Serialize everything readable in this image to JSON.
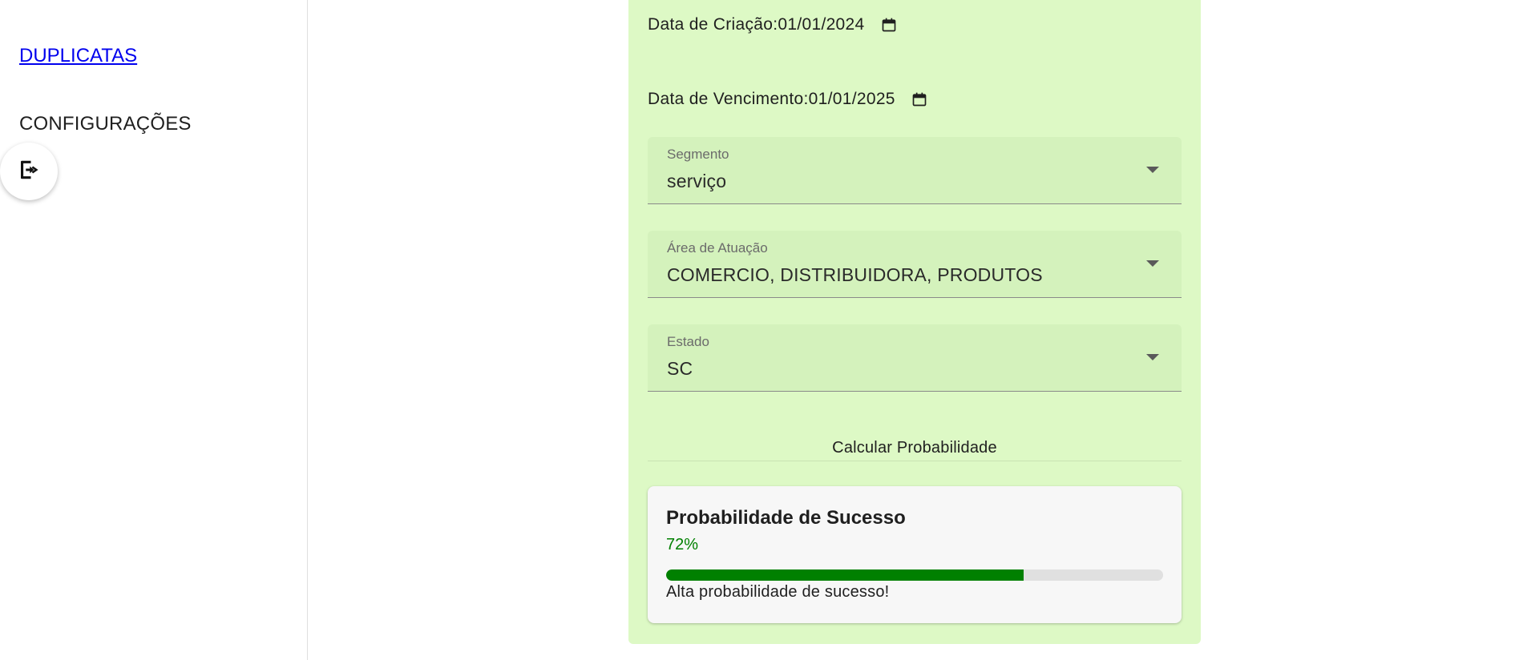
{
  "sidebar": {
    "nav_link": "DUPLICATAS",
    "nav_config": "CONFIGURAÇÕES",
    "logout_icon": "logout-icon"
  },
  "form": {
    "creation_date_label": "Data de Criação:",
    "creation_date_value": "01/01/2024",
    "due_date_label": "Data de Vencimento:",
    "due_date_value": "01/01/2025",
    "segment": {
      "label": "Segmento",
      "value": "serviço"
    },
    "area": {
      "label": "Área de Atuação",
      "value": "COMERCIO, DISTRIBUIDORA, PRODUTOS"
    },
    "state": {
      "label": "Estado",
      "value": "SC"
    },
    "calculate_button": "Calcular Probabilidade"
  },
  "result": {
    "title": "Probabilidade de Sucesso",
    "percent_text": "72%",
    "percent_value": 72,
    "message": "Alta probabilidade de sucesso!"
  },
  "colors": {
    "panel_bg": "#ddf9c5",
    "field_bg": "#d4f2bc",
    "success": "#008000",
    "link": "#0000ee"
  }
}
